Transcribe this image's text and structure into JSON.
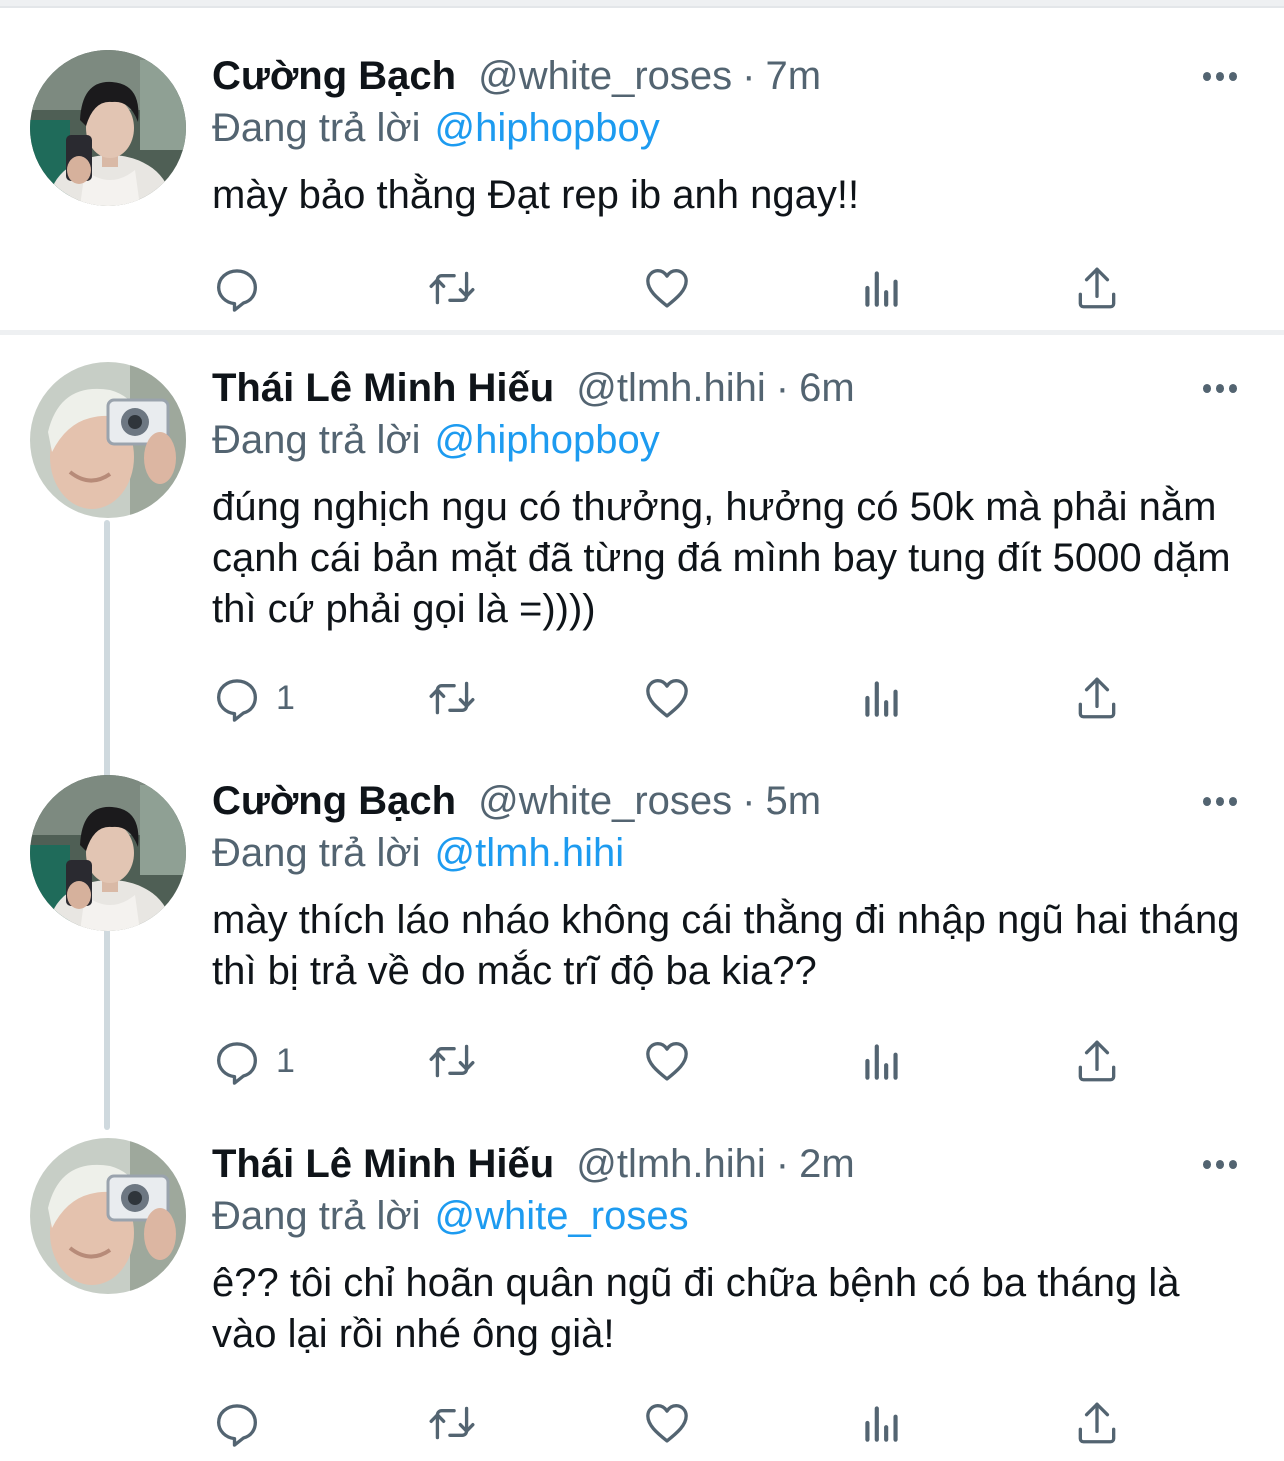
{
  "reply_label": "Đang trả lời",
  "tweets": [
    {
      "name": "Cường Bạch",
      "handle": "@white_roses",
      "separator": "·",
      "time": "7m",
      "reply_to": "@hiphopboy",
      "text": "mày bảo thằng Đạt rep ib anh ngay!!",
      "reply_count": "",
      "avatar": "avatar-cuong"
    },
    {
      "name": "Thái Lê Minh Hiếu",
      "handle": "@tlmh.hihi",
      "separator": "·",
      "time": "6m",
      "reply_to": "@hiphopboy",
      "text": "đúng nghịch ngu có thưởng, hưởng có 50k mà phải nằm cạnh cái bản mặt đã từng đá mình bay tung đít 5000 dặm thì cứ phải gọi là =))))",
      "reply_count": "1",
      "avatar": "avatar-hieu"
    },
    {
      "name": "Cường Bạch",
      "handle": "@white_roses",
      "separator": "·",
      "time": "5m",
      "reply_to": "@tlmh.hihi",
      "text": "mày thích láo nháo không cái thằng đi nhập ngũ hai tháng thì bị trả về do mắc trĩ độ ba kia??",
      "reply_count": "1",
      "avatar": "avatar-cuong"
    },
    {
      "name": "Thái Lê Minh Hiếu",
      "handle": "@tlmh.hihi",
      "separator": "·",
      "time": "2m",
      "reply_to": "@white_roses",
      "text": "ê?? tôi chỉ hoãn quân ngũ đi chữa bệnh có ba tháng là vào lại rồi nhé ông già!",
      "reply_count": "",
      "avatar": "avatar-hieu"
    }
  ],
  "icons": {
    "reply": "reply-icon",
    "retweet": "retweet-icon",
    "like": "heart-icon",
    "views": "analytics-icon",
    "share": "share-icon",
    "more": "more-icon"
  },
  "colors": {
    "text": "#0f1419",
    "secondary": "#536471",
    "link": "#1d9bf0",
    "thread_line": "#cfd9de"
  }
}
